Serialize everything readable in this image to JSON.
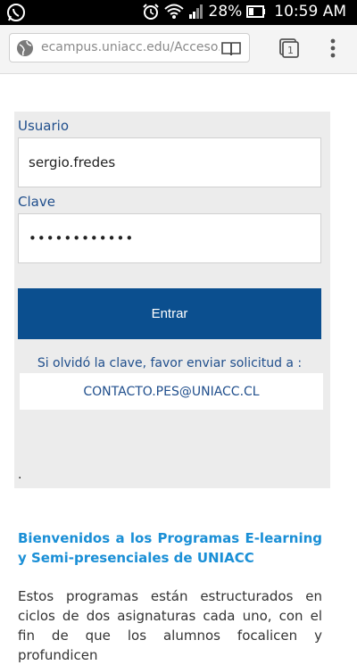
{
  "statusbar": {
    "battery": "28%",
    "time": "10:59 AM"
  },
  "browser": {
    "url": "ecampus.uniacc.edu/Acceso.m",
    "tab_count": "1"
  },
  "login": {
    "user_label": "Usuario",
    "user_value": "sergio.fredes",
    "password_label": "Clave",
    "password_value": "••••••••••••",
    "submit_label": "Entrar",
    "forgot_text": "Si olvidó la clave, favor enviar solicitud a :",
    "contact_email": "CONTACTO.PES@UNIACC.CL",
    "footnote": "."
  },
  "content": {
    "heading": "Bienvenidos a los Programas E-learning y Semi-presenciales de UNIACC",
    "paragraph": "Estos programas están estructurados en ciclos de dos asignaturas cada uno, con el fin de que los alumnos focalicen y profundicen"
  },
  "colors": {
    "primary": "#0b4f8f",
    "heading": "#1a8fd6",
    "label": "#1f4e8c"
  }
}
